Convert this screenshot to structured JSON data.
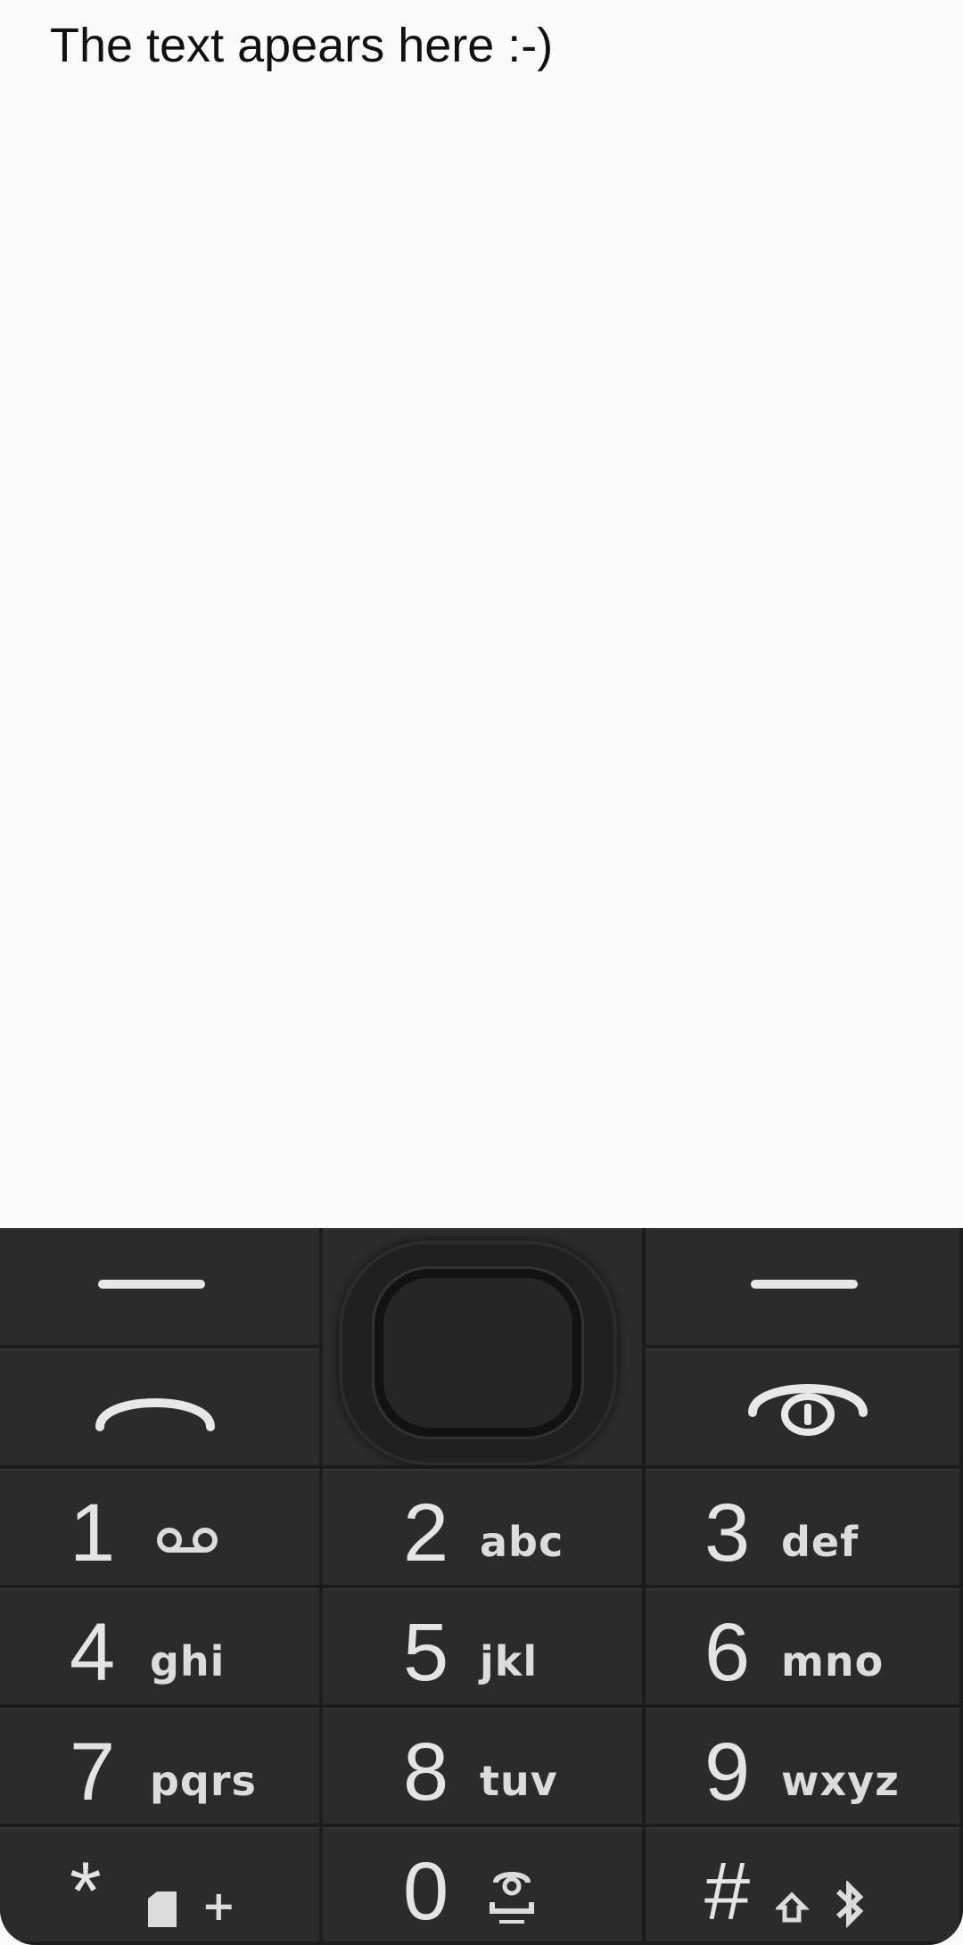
{
  "display": {
    "text": "The text apears here :-)"
  },
  "keypad": {
    "soft_left_icon": "left-soft-key-bar",
    "soft_right_icon": "right-soft-key-bar",
    "call_icon": "call-handset-icon",
    "end_icon": "power-end-icon",
    "nav_icon": "navigation-pad",
    "keys": [
      {
        "digit": "1",
        "letters": "",
        "icon": "voicemail-icon"
      },
      {
        "digit": "2",
        "letters": "abc"
      },
      {
        "digit": "3",
        "letters": "def"
      },
      {
        "digit": "4",
        "letters": "ghi"
      },
      {
        "digit": "5",
        "letters": "jkl"
      },
      {
        "digit": "6",
        "letters": "mno"
      },
      {
        "digit": "7",
        "letters": "pqrs"
      },
      {
        "digit": "8",
        "letters": "tuv"
      },
      {
        "digit": "9",
        "letters": "wxyz"
      },
      {
        "digit": "*",
        "letters": "+",
        "icon": "sim-icon"
      },
      {
        "digit": "0",
        "letters": "",
        "icon": "space-icon"
      },
      {
        "digit": "#",
        "letters": "",
        "icon": "shift-bluetooth-icon"
      }
    ],
    "colors": {
      "keypad_background": "#262626",
      "key_label": "#e4e4e4"
    }
  }
}
